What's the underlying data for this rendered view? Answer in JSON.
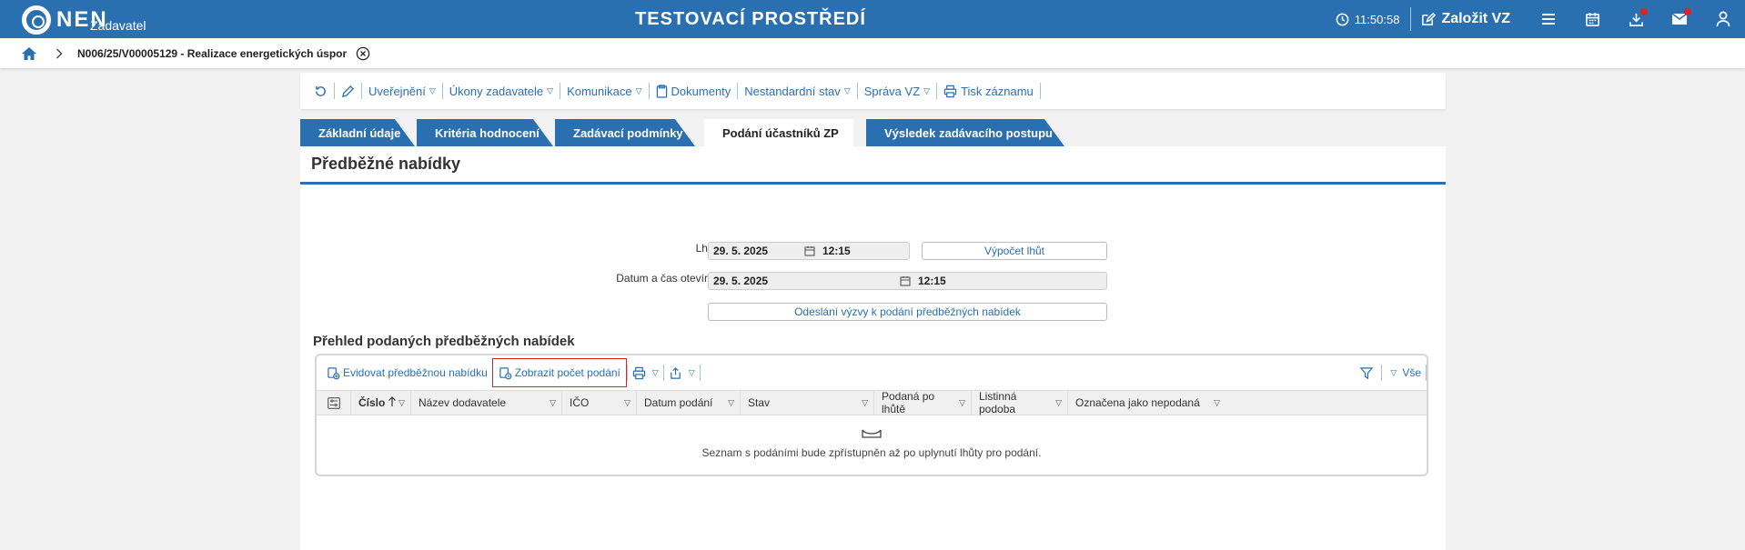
{
  "topbar": {
    "logo": "NEN",
    "logo_sub": "Zadavatel",
    "env_title": "TESTOVACÍ PROSTŘEDÍ",
    "time": "11:50:58",
    "new_vz_label": "Založit VZ",
    "icons": [
      "menu-icon",
      "calendar-icon",
      "download-icon",
      "mail-icon",
      "user-icon"
    ],
    "accent": "#2a6fb0",
    "badge_color": "#e0211c"
  },
  "breadcrumb": {
    "title": "N006/25/V00005129 - Realizace energetických úspor"
  },
  "toolbar": {
    "items": [
      "Uveřejnění",
      "Úkony zadavatele",
      "Komunikace",
      "Dokumenty",
      "Nestandardní stav",
      "Správa VZ",
      "Tisk záznamu"
    ]
  },
  "tabs": [
    {
      "label": "Základní údaje",
      "active": false
    },
    {
      "label": "Kritéria hodnocení",
      "active": false
    },
    {
      "label": "Zadávací podmínky",
      "active": false
    },
    {
      "label": "Podání účastníků ZP",
      "active": true
    },
    {
      "label": "Výsledek zadávacího postupu",
      "active": false
    }
  ],
  "section": {
    "title": "Předběžné nabídky",
    "deadline_label": "Lhůta:",
    "deadline_date": "29. 5. 2025",
    "deadline_time": "12:15",
    "calc_button": "Výpočet lhůt",
    "opening_label": "Datum a čas otevírání:",
    "opening_date": "29. 5. 2025",
    "opening_time": "12:15",
    "send_button": "Odeslání výzvy k podání předběžných nabídek"
  },
  "grid": {
    "title": "Přehled podaných předběžných nabídek",
    "evidovat": "Evidovat předběžnou nabídku",
    "zobrazit": "Zobrazit počet podání",
    "filter_all": "Vše",
    "columns": [
      "Číslo",
      "Název dodavatele",
      "IČO",
      "Datum podání",
      "Stav",
      "Podaná po lhůtě",
      "Listinná podoba",
      "Označena jako nepodaná"
    ],
    "empty_message": "Seznam s podáními bude zpřístupněn až po uplynutí lhůty pro podání."
  }
}
